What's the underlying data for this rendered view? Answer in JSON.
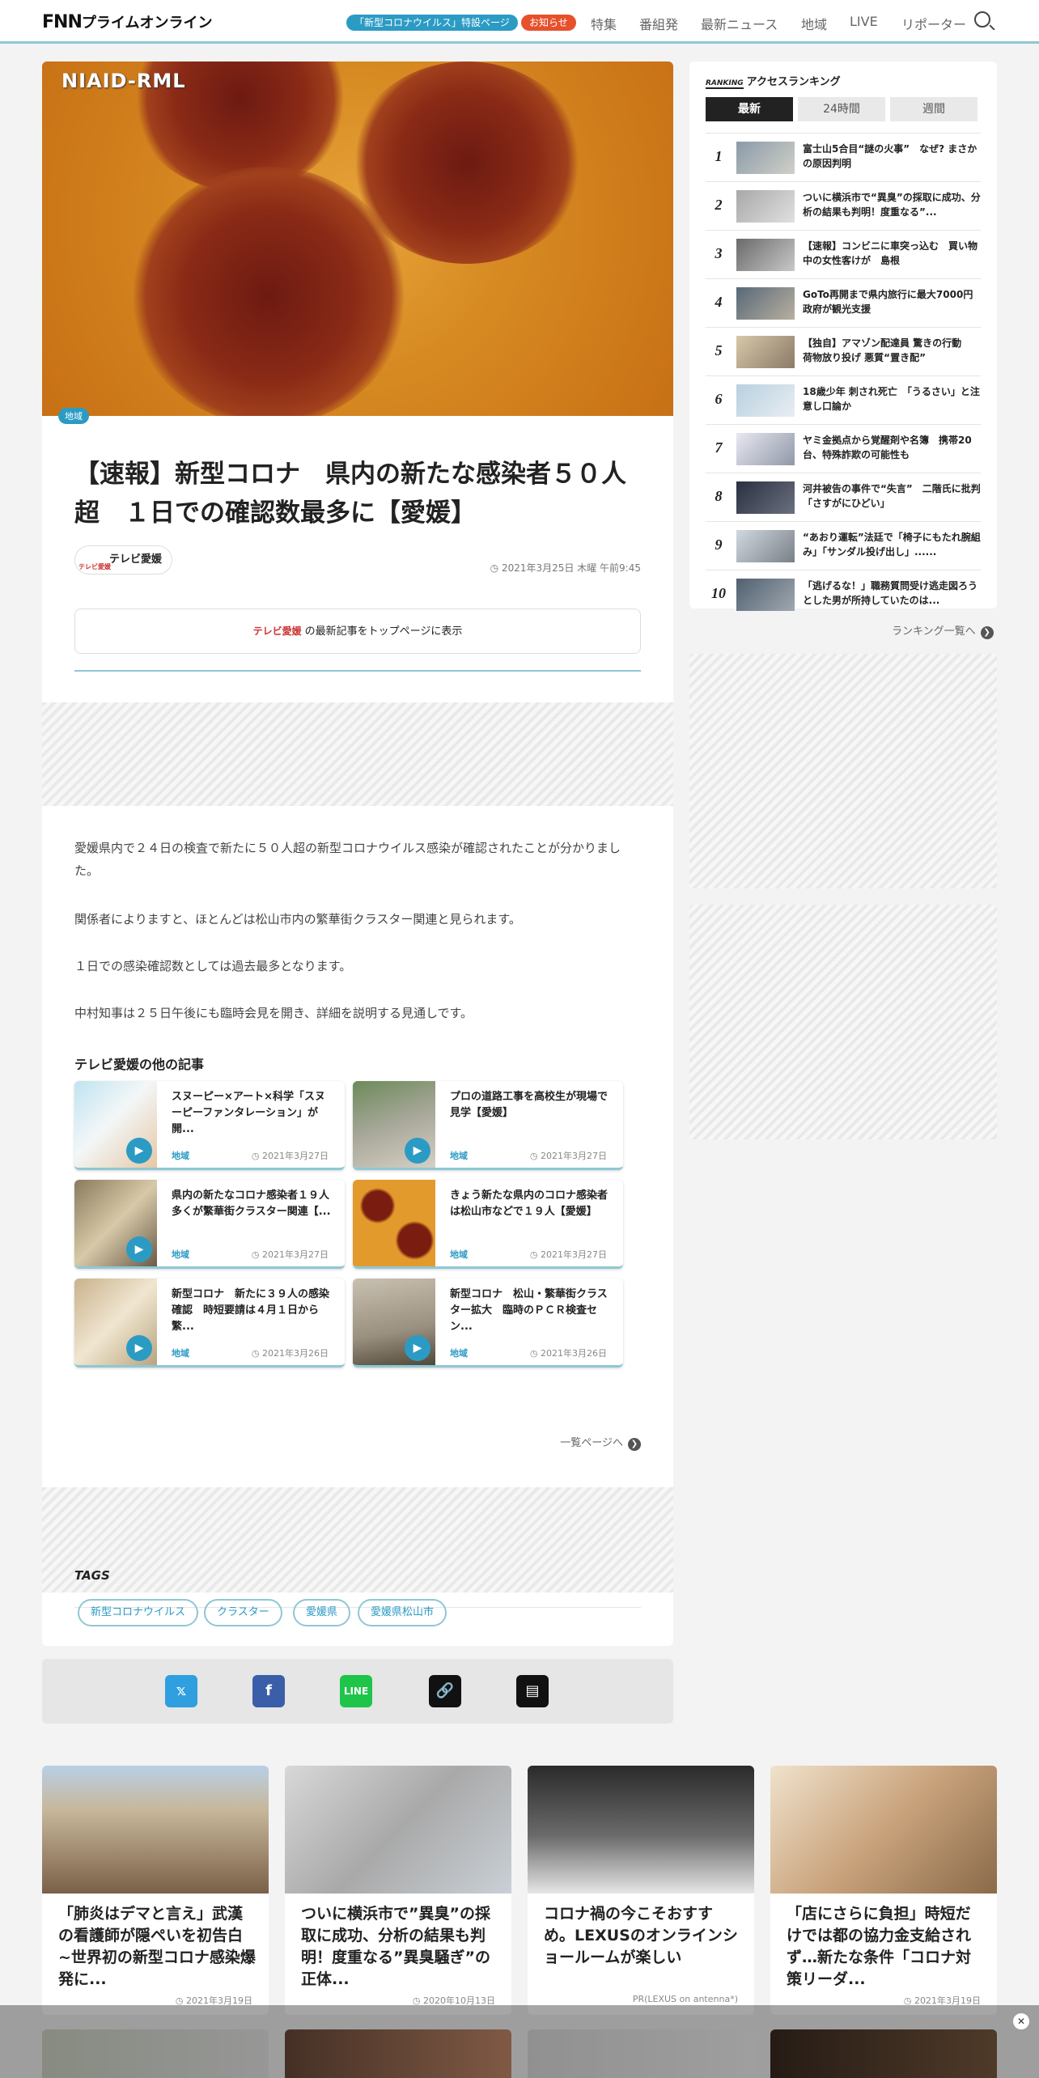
{
  "header": {
    "logo": "FNN",
    "logo_sub": "プライムオンライン",
    "covid_pill": "「新型コロナウイルス」特設ページ",
    "notice_pill": "お知らせ",
    "nav": [
      "特集",
      "番組発",
      "最新ニュース",
      "地域",
      "LIVE",
      "リポーター"
    ]
  },
  "article": {
    "hero_watermark": "NIAID-RML",
    "category": "地域",
    "title": "【速報】新型コロナ　県内の新たな感染者５０人超　１日での確認数最多に【愛媛】",
    "source": "テレビ愛媛",
    "date": "2021年3月25日 木曜 午前9:45",
    "top_link_logo": "テレビ愛媛",
    "top_link_text": "の最新記事をトップページに表示",
    "paragraphs": [
      "愛媛県内で２４日の検査で新たに５０人超の新型コロナウイルス感染が確認されたことが分かりました。",
      "関係者によりますと、ほとんどは松山市内の繁華街クラスター関連と見られます。",
      "１日での感染確認数としては過去最多となります。",
      "中村知事は２５日午後にも臨時会見を開き、詳細を説明する見通しです。"
    ]
  },
  "other_articles": {
    "heading": "テレビ愛媛の他の記事",
    "items": [
      {
        "title": "スヌーピー×アート×科学「スヌーピーファンタレーション」が開...",
        "category": "地域",
        "date": "2021年3月27日"
      },
      {
        "title": "プロの道路工事を高校生が現場で見学【愛媛】",
        "category": "地域",
        "date": "2021年3月27日"
      },
      {
        "title": "県内の新たなコロナ感染者１９人　多くが繁華街クラスター関連【...",
        "category": "地域",
        "date": "2021年3月27日"
      },
      {
        "title": "きょう新たな県内のコロナ感染者は松山市などで１９人【愛媛】",
        "category": "地域",
        "date": "2021年3月27日"
      },
      {
        "title": "新型コロナ　新たに３９人の感染確認　時短要請は４月１日から繁...",
        "category": "地域",
        "date": "2021年3月26日"
      },
      {
        "title": "新型コロナ　松山・繁華街クラスター拡大　臨時のＰＣＲ検査セン...",
        "category": "地域",
        "date": "2021年3月26日"
      }
    ],
    "more_link": "一覧ページへ"
  },
  "tags": {
    "heading": "TAGS",
    "items": [
      "新型コロナウイルス",
      "クラスター",
      "愛媛県",
      "愛媛県松山市"
    ]
  },
  "share": [
    "twitter",
    "facebook",
    "line",
    "link",
    "comment"
  ],
  "ranking": {
    "badge": "RANKING",
    "heading": "アクセスランキング",
    "tabs": [
      "最新",
      "24時間",
      "週間"
    ],
    "items": [
      {
        "num": "1",
        "title": "富士山5合目“謎の火事”　なぜ? まさかの原因判明"
      },
      {
        "num": "2",
        "title": "ついに横浜市で“異臭”の採取に成功、分析の結果も判明！度重なる”..."
      },
      {
        "num": "3",
        "title": "【速報】コンビニに車突っ込む　買い物中の女性客けが　島根"
      },
      {
        "num": "4",
        "title": "GoTo再開まで県内旅行に最大7000円　政府が観光支援"
      },
      {
        "num": "5",
        "title": "【独自】アマゾン配達員 驚きの行動　荷物放り投げ 悪質“置き配”"
      },
      {
        "num": "6",
        "title": "18歳少年 刺され死亡　「うるさい」と注意し口論か"
      },
      {
        "num": "7",
        "title": "ヤミ金拠点から覚醒剤や名簿　携帯20台、特殊詐欺の可能性も"
      },
      {
        "num": "8",
        "title": "河井被告の事件で“失言”　二階氏に批判「さすがにひどい」"
      },
      {
        "num": "9",
        "title": "“あおり運転”法廷で「椅子にもたれ腕組み」「サンダル投げ出し」......"
      },
      {
        "num": "10",
        "title": "「逃げるな！」職務質問受け逃走図ろうとした男が所持していたのは..."
      }
    ],
    "more_link": "ランキング一覧へ"
  },
  "bottom_cards": [
    {
      "title": "「肺炎はデマと言え」武漢の看護師が隠ぺいを初告白　~世界初の新型コロナ感染爆発に...",
      "date": "2021年3月19日"
    },
    {
      "title": "ついに横浜市で”異臭”の採取に成功、分析の結果も判明！度重なる”異臭騒ぎ”の正体...",
      "date": "2020年10月13日"
    },
    {
      "title": "コロナ禍の今こそおすすめ。LEXUSのオンラインショールームが楽しい",
      "date": "PR(LEXUS on antenna*)"
    },
    {
      "title": "「店にさらに負担」時短だけでは都の協力金支給されず…新たな条件「コロナ対策リーダ...",
      "date": "2021年3月19日"
    }
  ],
  "colors": {
    "accent": "#2b9bc4",
    "notice": "#e8502c",
    "line": "#8fc7d5"
  }
}
